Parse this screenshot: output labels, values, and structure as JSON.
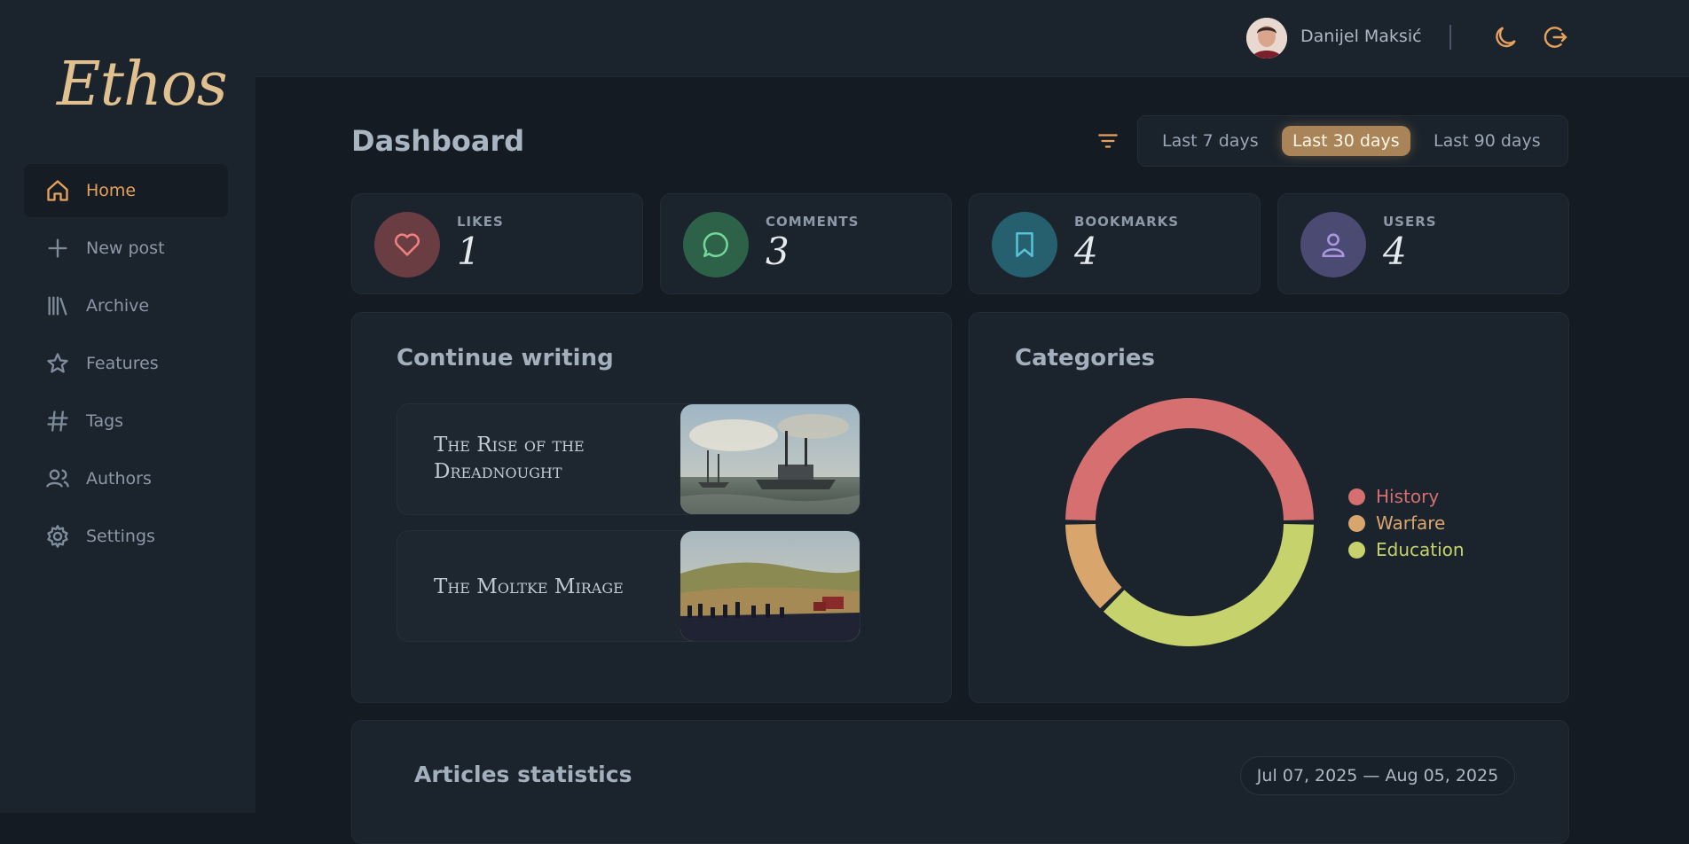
{
  "app": {
    "logo": "Ethos"
  },
  "user": {
    "name": "Danijel Maksić"
  },
  "sidebar": {
    "items": [
      {
        "label": "Home",
        "icon": "home-icon",
        "active": true
      },
      {
        "label": "New post",
        "icon": "plus-icon"
      },
      {
        "label": "Archive",
        "icon": "library-icon"
      },
      {
        "label": "Features",
        "icon": "star-icon"
      },
      {
        "label": "Tags",
        "icon": "hash-icon"
      },
      {
        "label": "Authors",
        "icon": "users-icon"
      },
      {
        "label": "Settings",
        "icon": "gear-icon"
      }
    ]
  },
  "header": {
    "title": "Dashboard",
    "ranges": [
      "Last 7 days",
      "Last 30 days",
      "Last 90 days"
    ],
    "active_range": "Last 30 days"
  },
  "stats": [
    {
      "label": "LIKES",
      "value": "1",
      "icon": "heart-icon",
      "color": "#f08080"
    },
    {
      "label": "COMMENTS",
      "value": "3",
      "icon": "chat-icon",
      "color": "#73d69a"
    },
    {
      "label": "BOOKMARKS",
      "value": "4",
      "icon": "bookmark-icon",
      "color": "#58c2d6"
    },
    {
      "label": "USERS",
      "value": "4",
      "icon": "user-icon",
      "color": "#a997e0"
    }
  ],
  "continue_writing": {
    "title": "Continue writing",
    "posts": [
      {
        "title_line1": "The Rise of the",
        "title_line2": "Dreadnought"
      },
      {
        "title_line1": "The Moltke Mirage",
        "title_line2": ""
      }
    ]
  },
  "categories": {
    "title": "Categories",
    "chart_data": {
      "type": "pie",
      "categories": [
        "History",
        "Warfare",
        "Education"
      ],
      "values": [
        2,
        0.5,
        1.5
      ],
      "colors": [
        "#d56f70",
        "#d8a66d",
        "#c6d36d"
      ],
      "legend": "right"
    }
  },
  "articles_statistics": {
    "title": "Articles statistics",
    "date_range": "Jul 07, 2025 — Aug 05, 2025"
  },
  "colors": {
    "accent": "#e6a15c",
    "background": "#141b23",
    "panel": "#1b232c"
  }
}
